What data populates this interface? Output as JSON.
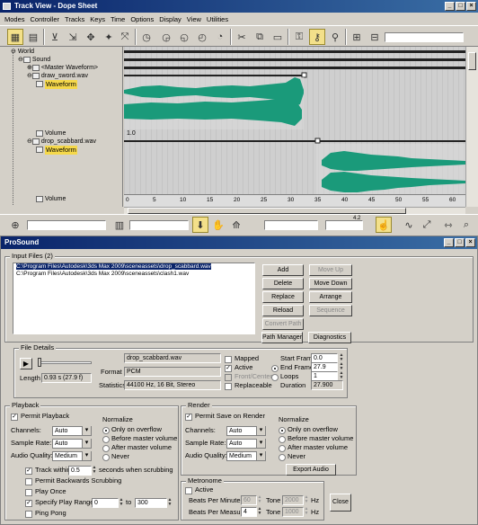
{
  "window": {
    "title": "Track View - Dope Sheet"
  },
  "menu": [
    "Modes",
    "Controller",
    "Tracks",
    "Keys",
    "Time",
    "Options",
    "Display",
    "View",
    "Utilities"
  ],
  "tree": {
    "world": "World",
    "sound": "Sound",
    "master": "<Master Waveform>",
    "draw": "draw_sword.wav",
    "waveform1": "Waveform",
    "volume1": "Volume",
    "drop": "drop_scabbard.wav",
    "waveform2": "Waveform",
    "volume2": "Volume"
  },
  "track": {
    "volume_label": "1.0"
  },
  "ruler": [
    "0",
    "5",
    "10",
    "15",
    "20",
    "25",
    "30",
    "35",
    "40",
    "45",
    "50",
    "55",
    "60"
  ],
  "status": {
    "value": "4.2"
  },
  "prosound": {
    "title": "ProSound",
    "input_files": {
      "title": "Input Files (2)",
      "files": [
        "C:\\Program Files\\Autodesk\\3ds Max 2009\\sceneassets\\drop_scabbard.wav",
        "C:\\Program Files\\Autodesk\\3ds Max 2009\\sceneassets\\clash1.wav"
      ],
      "buttons": {
        "add": "Add",
        "delete": "Delete",
        "replace": "Replace",
        "reload": "Reload",
        "convert_path": "Convert Path",
        "path_manager": "Path Manager",
        "move_up": "Move Up",
        "move_down": "Move Down",
        "arrange": "Arrange",
        "sequence": "Sequence",
        "diagnostics": "Diagnostics"
      }
    },
    "file_details": {
      "title": "File Details",
      "filename": "drop_scabbard.wav",
      "length_label": "Length",
      "length_value": "0.93 s (27.9 f)",
      "format_label": "Format",
      "format_value": "PCM",
      "statistics_label": "Statistics",
      "statistics_value": "44100 Hz, 16 Bit, Stereo",
      "mapped": "Mapped",
      "active": "Active",
      "front_center": "Front/Center",
      "replaceable": "Replaceable",
      "start_frame_label": "Start Frame",
      "start_frame": "0.0",
      "end_frame_label": "End Frame",
      "end_frame": "27.9",
      "loops_label": "Loops",
      "loops": "1",
      "duration_label": "Duration",
      "duration": "27.900"
    },
    "playback": {
      "title": "Playback",
      "permit": "Permit Playback",
      "channels_label": "Channels:",
      "channels": "Auto",
      "sample_rate_label": "Sample Rate:",
      "sample_rate": "Auto",
      "audio_quality_label": "Audio Quality:",
      "audio_quality": "Medium",
      "normalize_label": "Normalize",
      "normalize": [
        "Only on overflow",
        "Before master volume",
        "After master volume",
        "Never"
      ],
      "track_within": "Track within",
      "track_within_value": "0.5",
      "track_within_suffix": "seconds when scrubbing",
      "permit_backwards": "Permit Backwards Scrubbing",
      "play_once": "Play Once",
      "specify_range": "Specify Play Range",
      "range_from": "0",
      "range_to_label": "to",
      "range_to": "300",
      "ping_pong": "Ping Pong"
    },
    "render": {
      "title": "Render",
      "permit": "Permit Save on Render",
      "channels_label": "Channels:",
      "channels": "Auto",
      "sample_rate_label": "Sample Rate:",
      "sample_rate": "Auto",
      "audio_quality_label": "Audio Quality:",
      "audio_quality": "Medium",
      "normalize_label": "Normalize",
      "normalize": [
        "Only on overflow",
        "Before master volume",
        "After master volume",
        "Never"
      ],
      "export": "Export Audio"
    },
    "metronome": {
      "title": "Metronome",
      "active": "Active",
      "bpm_label": "Beats Per Minute",
      "bpm": "60",
      "tone1_label": "Tone",
      "tone1": "2000",
      "hz1": "Hz",
      "bpmeasure_label": "Beats Per Measure",
      "bpmeasure": "4",
      "tone2_label": "Tone",
      "tone2": "1000",
      "hz2": "Hz"
    },
    "close": "Close"
  },
  "colors": {
    "waveform": "#1a9a7a",
    "selected_track": "#f5d84a",
    "titlebar": "#0a246a"
  }
}
